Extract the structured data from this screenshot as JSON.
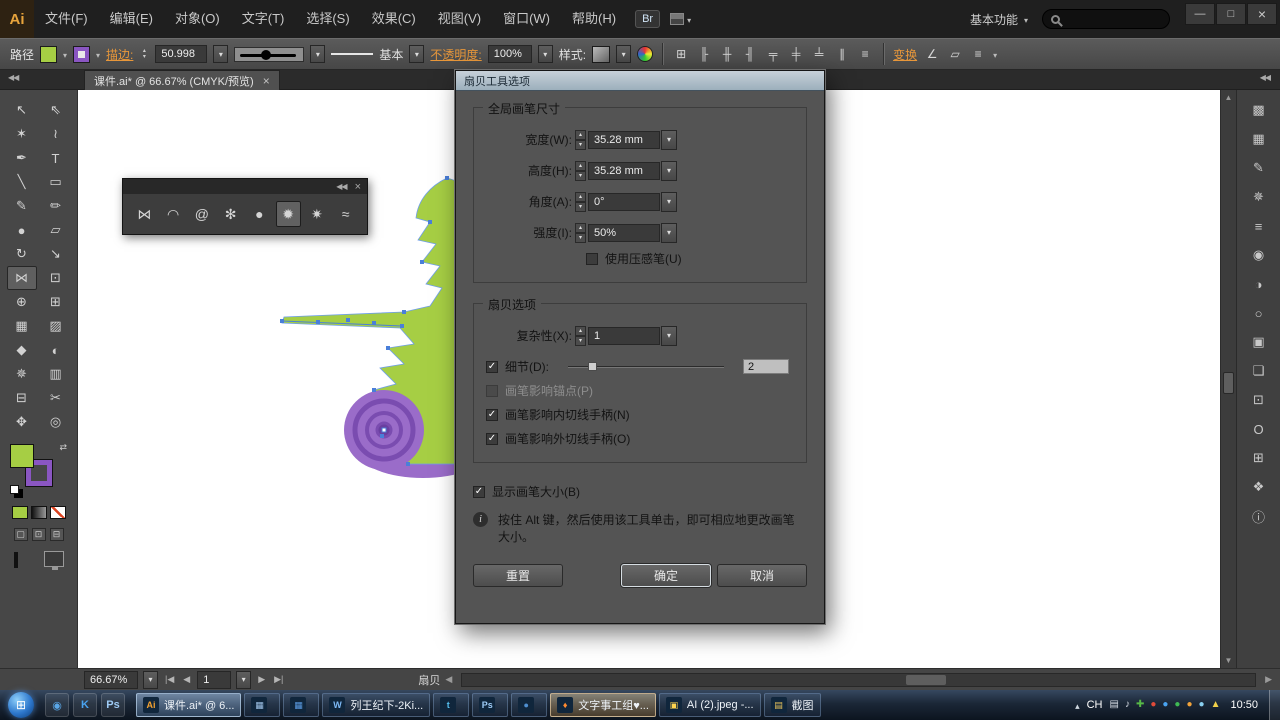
{
  "menubar": {
    "logo": "Ai",
    "items": [
      {
        "name": "menu-file",
        "label": "文件(F)"
      },
      {
        "name": "menu-edit",
        "label": "编辑(E)"
      },
      {
        "name": "menu-object",
        "label": "对象(O)"
      },
      {
        "name": "menu-type",
        "label": "文字(T)"
      },
      {
        "name": "menu-select",
        "label": "选择(S)"
      },
      {
        "name": "menu-effect",
        "label": "效果(C)"
      },
      {
        "name": "menu-view",
        "label": "视图(V)"
      },
      {
        "name": "menu-window",
        "label": "窗口(W)"
      },
      {
        "name": "menu-help",
        "label": "帮助(H)"
      }
    ],
    "bridge_label": "Br",
    "workspace_label": "基本功能"
  },
  "controlbar": {
    "selection_type": "路径",
    "stroke_label": "描边:",
    "stroke_weight": "50.998",
    "brush_style": "基本",
    "opacity_label": "不透明度:",
    "opacity_value": "100%",
    "style_label": "样式:",
    "transform_label": "变换",
    "icons_a": [
      {
        "name": "document-setup-icon",
        "glyph": "⊞"
      },
      {
        "name": "align-left-icon",
        "glyph": "╟"
      },
      {
        "name": "align-center-horizontal-icon",
        "glyph": "╫"
      },
      {
        "name": "align-right-icon",
        "glyph": "╢"
      },
      {
        "name": "align-top-icon",
        "glyph": "╤"
      },
      {
        "name": "align-center-vertical-icon",
        "glyph": "╪"
      },
      {
        "name": "align-bottom-icon",
        "glyph": "╧"
      },
      {
        "name": "distribute-horizontal-icon",
        "glyph": "∥"
      },
      {
        "name": "distribute-vertical-icon",
        "glyph": "≡"
      }
    ],
    "icons_b": [
      {
        "name": "shear-icon",
        "glyph": "∠"
      },
      {
        "name": "isolate-mode-icon",
        "glyph": "▱"
      },
      {
        "name": "panel-menu-icon",
        "glyph": "≡"
      }
    ]
  },
  "doc_tab": {
    "title": "课件.ai* @ 66.67% (CMYK/预览)"
  },
  "tools": {
    "items": [
      {
        "name": "selection-tool",
        "glyph": "↖"
      },
      {
        "name": "direct-selection-tool",
        "glyph": "⇖"
      },
      {
        "name": "magic-wand-tool",
        "glyph": "✶"
      },
      {
        "name": "lasso-tool",
        "glyph": "≀"
      },
      {
        "name": "pen-tool",
        "glyph": "✒"
      },
      {
        "name": "type-tool",
        "glyph": "T"
      },
      {
        "name": "line-segment-tool",
        "glyph": "╲"
      },
      {
        "name": "rectangle-tool",
        "glyph": "▭"
      },
      {
        "name": "paintbrush-tool",
        "glyph": "✎"
      },
      {
        "name": "pencil-tool",
        "glyph": "✏"
      },
      {
        "name": "blob-brush-tool",
        "glyph": "●"
      },
      {
        "name": "eraser-tool",
        "glyph": "▱"
      },
      {
        "name": "rotate-tool",
        "glyph": "↻"
      },
      {
        "name": "scale-tool",
        "glyph": "↘"
      },
      {
        "name": "width-tool",
        "glyph": "⋈",
        "selected": true
      },
      {
        "name": "free-transform-tool",
        "glyph": "⊡"
      },
      {
        "name": "shape-builder-tool",
        "glyph": "⊕"
      },
      {
        "name": "perspective-grid-tool",
        "glyph": "⊞"
      },
      {
        "name": "mesh-tool",
        "glyph": "▦"
      },
      {
        "name": "gradient-tool",
        "glyph": "▨"
      },
      {
        "name": "eyedropper-tool",
        "glyph": "◆"
      },
      {
        "name": "blend-tool",
        "glyph": "◐"
      },
      {
        "name": "symbol-sprayer-tool",
        "glyph": "✵"
      },
      {
        "name": "column-graph-tool",
        "glyph": "▥"
      },
      {
        "name": "artboard-tool",
        "glyph": "⊟"
      },
      {
        "name": "slice-tool",
        "glyph": "✂"
      },
      {
        "name": "hand-tool",
        "glyph": "✥"
      },
      {
        "name": "zoom-tool",
        "glyph": "◎"
      }
    ]
  },
  "liquify_panel": {
    "tools": [
      {
        "name": "width-tool-icon",
        "glyph": "⋈"
      },
      {
        "name": "warp-tool-icon",
        "glyph": "◠"
      },
      {
        "name": "twirl-tool-icon",
        "glyph": "@"
      },
      {
        "name": "pucker-tool-icon",
        "glyph": "✻"
      },
      {
        "name": "bloat-tool-icon",
        "glyph": "●"
      },
      {
        "name": "scallop-tool-icon",
        "glyph": "✹",
        "selected": true
      },
      {
        "name": "crystallize-tool-icon",
        "glyph": "✷"
      },
      {
        "name": "wrinkle-tool-icon",
        "glyph": "≈"
      }
    ]
  },
  "dock": {
    "items": [
      {
        "name": "color-panel-icon",
        "glyph": "▩"
      },
      {
        "name": "swatches-panel-icon",
        "glyph": "▦"
      },
      {
        "name": "brushes-panel-icon",
        "glyph": "✎"
      },
      {
        "name": "symbols-panel-icon",
        "glyph": "✵"
      },
      {
        "name": "stroke-panel-icon",
        "glyph": "≡"
      },
      {
        "name": "gradient-panel-icon",
        "glyph": "◉"
      },
      {
        "name": "transparency-panel-icon",
        "glyph": "◑"
      },
      {
        "name": "appearance-panel-icon",
        "glyph": "○"
      },
      {
        "name": "graphic-styles-panel-icon",
        "glyph": "▣"
      },
      {
        "name": "layers-panel-icon",
        "glyph": "❏"
      },
      {
        "name": "artboards-panel-icon",
        "glyph": "⊡"
      },
      {
        "name": "character-panel-icon",
        "glyph": "O"
      },
      {
        "name": "transform-panel-icon",
        "glyph": "⊞"
      },
      {
        "name": "pathfinder-panel-icon",
        "glyph": "❖"
      },
      {
        "name": "info-panel-icon",
        "glyph": "ⓘ"
      }
    ]
  },
  "artwork": {
    "green": "#a6ce44",
    "purple": "#9a6cc9",
    "purple_dark": "#7a4cb0",
    "blue": "#4a7fd9"
  },
  "dialog": {
    "title": "扇贝工具选项",
    "global_brush": {
      "title": "全局画笔尺寸",
      "rows": [
        {
          "name": "width-row",
          "label": "宽度(W):",
          "value": "35.28 mm"
        },
        {
          "name": "height-row",
          "label": "高度(H):",
          "value": "35.28 mm"
        },
        {
          "name": "angle-row",
          "label": "角度(A):",
          "value": "0°"
        },
        {
          "name": "intensity-row",
          "label": "强度(I):",
          "value": "50%"
        }
      ],
      "pressure_pen": {
        "label": "使用压感笔(U)",
        "checked": false
      }
    },
    "scallop_options": {
      "title": "扇贝选项",
      "complexity": {
        "label": "复杂性(X):",
        "value": "1"
      },
      "detail": {
        "label": "细节(D):",
        "value": "2",
        "checked": true
      },
      "checks": [
        {
          "name": "brush-affects-anchor-checkbox",
          "label": "画笔影响锚点(P)",
          "checked": false,
          "disabled": true
        },
        {
          "name": "brush-affects-in-tangent-checkbox",
          "label": "画笔影响内切线手柄(N)",
          "checked": true
        },
        {
          "name": "brush-affects-out-tangent-checkbox",
          "label": "画笔影响外切线手柄(O)",
          "checked": true
        }
      ]
    },
    "show_brush_size": {
      "label": "显示画笔大小(B)",
      "checked": true
    },
    "info_text": "按住 Alt 键，然后使用该工具单击，即可相应地更改画笔大小。",
    "buttons": {
      "reset": "重置",
      "ok": "确定",
      "cancel": "取消"
    }
  },
  "statusbar": {
    "zoom": "66.67%",
    "artboard": "1",
    "tool_name": "扇贝"
  },
  "taskbar": {
    "quicklaunch": [
      {
        "name": "quicklaunch-browser",
        "glyph": "◉",
        "color": "#5aa7e8"
      },
      {
        "name": "quicklaunch-k",
        "glyph": "K",
        "color": "#4aa3f0"
      },
      {
        "name": "quicklaunch-photoshop",
        "glyph": "Ps",
        "color": "#9ecbf5"
      }
    ],
    "windows": [
      {
        "name": "taskbar-window-illustrator",
        "glyph": "Ai",
        "color": "#f5a230",
        "label": "课件.ai* @ 6...",
        "active": true
      },
      {
        "name": "taskbar-window-app1",
        "glyph": "▦",
        "color": "#9fc3e8"
      },
      {
        "name": "taskbar-window-app2",
        "glyph": "▦",
        "color": "#5a9ae0"
      },
      {
        "name": "taskbar-window-word",
        "glyph": "W",
        "color": "#7db9f5",
        "label": "列王纪下-2Ki..."
      },
      {
        "name": "taskbar-window-twitter",
        "glyph": "t",
        "color": "#55c0f0"
      },
      {
        "name": "taskbar-window-photoshop",
        "glyph": "Ps",
        "color": "#9ecbf5"
      },
      {
        "name": "taskbar-window-app3",
        "glyph": "●",
        "color": "#4f8fd0"
      },
      {
        "name": "taskbar-window-wenzi",
        "glyph": "♦",
        "color": "#ff8a30",
        "label": "文字事工组♥...",
        "highlight": true
      },
      {
        "name": "taskbar-window-image-viewer",
        "glyph": "▣",
        "color": "#ffd54f",
        "label": "AI (2).jpeg -..."
      },
      {
        "name": "taskbar-window-jietu",
        "glyph": "▤",
        "color": "#e8c35a",
        "label": "截图"
      }
    ],
    "tray_icons": [
      {
        "name": "tray-ime-icon",
        "glyph": "▤",
        "color": "#d8dee6"
      },
      {
        "name": "tray-volume-icon",
        "glyph": "♪",
        "color": "#d8dee6"
      },
      {
        "name": "tray-safety-icon",
        "glyph": "✚",
        "color": "#57b947"
      },
      {
        "name": "tray-alert-icon",
        "glyph": "●",
        "color": "#e04b3a"
      },
      {
        "name": "tray-qq-icon",
        "glyph": "●",
        "color": "#4aa3f0"
      },
      {
        "name": "tray-wechat-icon",
        "glyph": "●",
        "color": "#3fba54"
      },
      {
        "name": "tray-music-icon",
        "glyph": "●",
        "color": "#f2a33a"
      },
      {
        "name": "tray-cloud-icon",
        "glyph": "●",
        "color": "#8ad0f0"
      },
      {
        "name": "tray-update-icon",
        "glyph": "▲",
        "color": "#f0d04a"
      }
    ],
    "lang": "CH",
    "time": "10:50"
  }
}
